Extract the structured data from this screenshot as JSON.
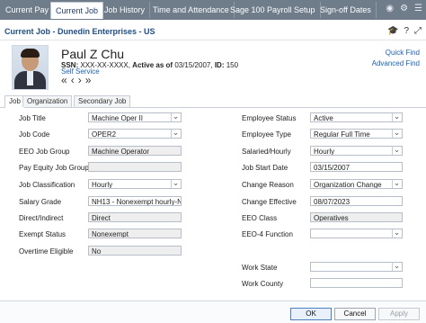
{
  "top_tabs": [
    "Current Pay",
    "Current Job",
    "Job History",
    "Time and Attendance",
    "Sage 100 Payroll Setup",
    "Sign-off Dates"
  ],
  "active_top_tab": "Current Job",
  "title": "Current Job - Dunedin Enterprises - US",
  "employee": {
    "name": "Paul Z Chu",
    "ssn_label": "SSN:",
    "ssn_value": "XXX-XX-XXXX,",
    "active_label": "Active as of",
    "active_date": "03/15/2007,",
    "id_label": "ID:",
    "id_value": "150",
    "self_service": "Self Service"
  },
  "links": {
    "quick_find": "Quick Find",
    "advanced_find": "Advanced Find"
  },
  "sub_tabs": [
    "Job",
    "Organization",
    "Secondary Job"
  ],
  "left_fields": {
    "job_title": {
      "label": "Job Title",
      "value": "Machine Oper II"
    },
    "job_code": {
      "label": "Job Code",
      "value": "OPER2"
    },
    "eeo_job_group": {
      "label": "EEO Job Group",
      "value": "Machine Operator"
    },
    "pay_equity_job_group": {
      "label": "Pay Equity Job Group",
      "value": ""
    },
    "job_classification": {
      "label": "Job Classification",
      "value": "Hourly"
    },
    "salary_grade": {
      "label": "Salary Grade",
      "value": "NH13 - Nonexempt hourly-N"
    },
    "direct_indirect": {
      "label": "Direct/Indirect",
      "value": "Direct"
    },
    "exempt_status": {
      "label": "Exempt Status",
      "value": "Nonexempt"
    },
    "overtime_eligible": {
      "label": "Overtime Eligible",
      "value": "No"
    }
  },
  "right_fields": {
    "employee_status": {
      "label": "Employee Status",
      "value": "Active"
    },
    "employee_type": {
      "label": "Employee Type",
      "value": "Regular Full Time"
    },
    "salaried_hourly": {
      "label": "Salaried/Hourly",
      "value": "Hourly"
    },
    "job_start_date": {
      "label": "Job Start Date",
      "value": "03/15/2007"
    },
    "change_reason": {
      "label": "Change Reason",
      "value": "Organization Change"
    },
    "change_effective": {
      "label": "Change Effective",
      "value": "08/07/2023"
    },
    "eeo_class": {
      "label": "EEO Class",
      "value": "Operatives"
    },
    "eeo4_function": {
      "label": "EEO-4 Function",
      "value": ""
    },
    "work_state": {
      "label": "Work State",
      "value": ""
    },
    "work_county": {
      "label": "Work County",
      "value": ""
    }
  },
  "buttons": {
    "ok": "OK",
    "cancel": "Cancel",
    "apply": "Apply"
  },
  "icons": {
    "top": [
      "user-icon",
      "gear-icon",
      "menu-icon"
    ],
    "title": [
      "graduation-cap-icon",
      "help-icon",
      "expand-icon"
    ]
  }
}
